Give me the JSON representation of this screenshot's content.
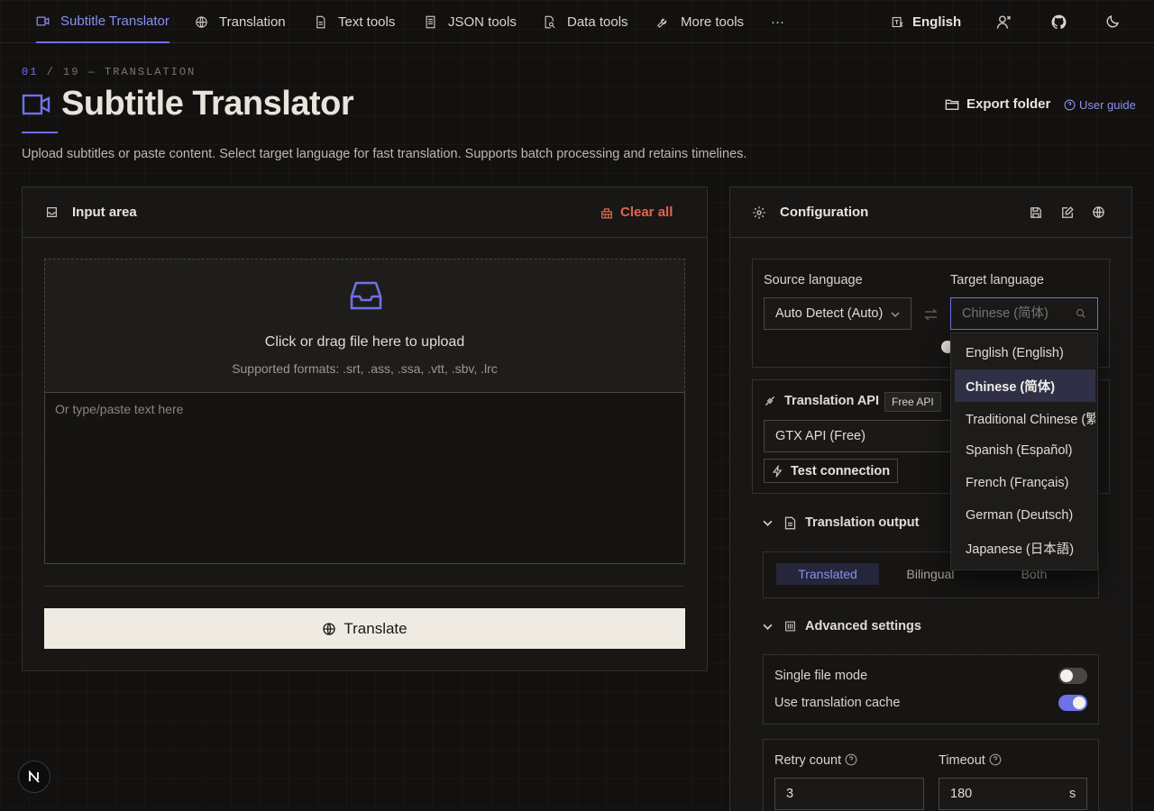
{
  "nav": {
    "items": [
      {
        "label": "Subtitle Translator",
        "icon": "video-icon",
        "active": true
      },
      {
        "label": "Translation",
        "icon": "globe-icon"
      },
      {
        "label": "Text tools",
        "icon": "document-icon"
      },
      {
        "label": "JSON tools",
        "icon": "list-doc-icon"
      },
      {
        "label": "Data tools",
        "icon": "search-doc-icon"
      },
      {
        "label": "More tools",
        "icon": "wrench-icon"
      }
    ],
    "more": "···",
    "language": "English"
  },
  "header": {
    "crumb_num": "01",
    "crumb_rest": " / 19 — TRANSLATION",
    "title": "Subtitle Translator",
    "subtitle": "Upload subtitles or paste content. Select target language for fast translation. Supports batch processing and retains timelines.",
    "export_label": "Export folder",
    "guide_label": "User guide"
  },
  "input_panel": {
    "title": "Input area",
    "clear_label": "Clear all",
    "upload_title": "Click or drag file here to upload",
    "upload_formats": "Supported formats: .srt, .ass, .ssa, .vtt, .sbv, .lrc",
    "textarea_placeholder": "Or type/paste text here",
    "translate_label": "Translate"
  },
  "config": {
    "title": "Configuration",
    "source_label": "Source language",
    "source_value": "Auto Detect (Auto)",
    "target_label": "Target language",
    "target_placeholder": "Chinese (简体)",
    "api_label": "Translation API",
    "api_badge": "Free API",
    "api_value": "GTX API (Free)",
    "test_label": "Test connection",
    "output_title": "Translation output",
    "output_options": [
      "Translated",
      "Bilingual",
      "Both"
    ],
    "output_selected": "Translated",
    "advanced_title": "Advanced settings",
    "single_file_label": "Single file mode",
    "single_file_on": false,
    "cache_label": "Use translation cache",
    "cache_on": true,
    "retry_label": "Retry count",
    "retry_value": "3",
    "timeout_label": "Timeout",
    "timeout_value": "180",
    "timeout_unit": "s"
  },
  "dropdown": {
    "options": [
      "English (English)",
      "Chinese (简体)",
      "Traditional Chinese (繁體)",
      "Spanish (Español)",
      "French (Français)",
      "German (Deutsch)",
      "Japanese (日本語)"
    ],
    "selected": "Chinese (简体)"
  },
  "colors": {
    "accent": "#6e72e6",
    "danger": "#e0654f",
    "background": "#121110"
  }
}
